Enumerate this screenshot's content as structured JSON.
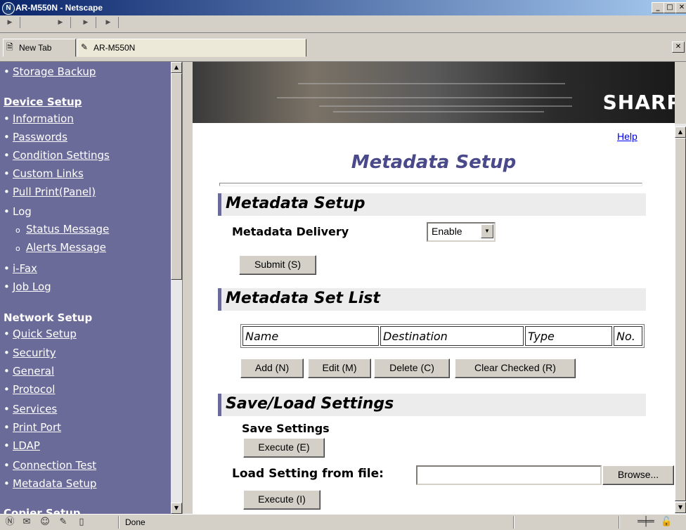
{
  "window": {
    "title": "AR-M550N - Netscape"
  },
  "tabs": [
    {
      "label": "New Tab",
      "icon": "new-tab-icon"
    },
    {
      "label": "AR-M550N",
      "icon": "page-icon"
    }
  ],
  "sidebar": {
    "top_link": "Storage Backup",
    "device_setup": {
      "heading": "Device Setup",
      "items": [
        "Information",
        "Passwords",
        "Condition Settings",
        "Custom Links",
        "Pull Print(Panel)"
      ],
      "log_label": "Log",
      "log_sub": [
        "Status Message",
        "Alerts Message"
      ],
      "items_after": [
        "i-Fax",
        "Job Log"
      ]
    },
    "network_setup": {
      "heading": "Network Setup",
      "items": [
        "Quick Setup",
        "Security",
        "General",
        "Protocol",
        "Services",
        "Print Port",
        "LDAP",
        "Connection Test",
        "Metadata Setup"
      ]
    },
    "partial_heading": "Copier Setup"
  },
  "main": {
    "banner_logo": "SHARP",
    "help_link": "Help",
    "page_title": "Metadata Setup",
    "section1": {
      "heading": "Metadata Setup",
      "delivery_label": "Metadata Delivery",
      "delivery_value": "Enable",
      "submit": "Submit (S)"
    },
    "section2": {
      "heading": "Metadata Set List",
      "columns": [
        "Name",
        "Destination",
        "Type",
        "No."
      ],
      "buttons": [
        "Add (N)",
        "Edit (M)",
        "Delete (C)",
        "Clear Checked (R)"
      ]
    },
    "section3": {
      "heading": "Save/Load Settings",
      "save_label": "Save Settings",
      "execute_save": "Execute (E)",
      "load_label": "Load Setting from file:",
      "file_value": "",
      "browse": "Browse...",
      "execute_load": "Execute (I)"
    }
  },
  "status": {
    "text": "Done"
  }
}
